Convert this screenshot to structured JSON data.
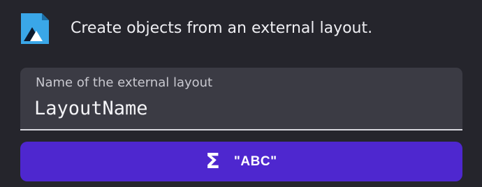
{
  "header": {
    "icon": "external-layout-icon",
    "description": "Create objects from an external layout."
  },
  "field": {
    "label": "Name of the external layout",
    "value": "LayoutName"
  },
  "expression_button": {
    "icon": "sigma-icon",
    "label": "\"ABC\""
  },
  "colors": {
    "background": "#25252c",
    "field_background": "#3b3b44",
    "accent": "#4e27cf",
    "icon_blue": "#3aa7e8"
  }
}
